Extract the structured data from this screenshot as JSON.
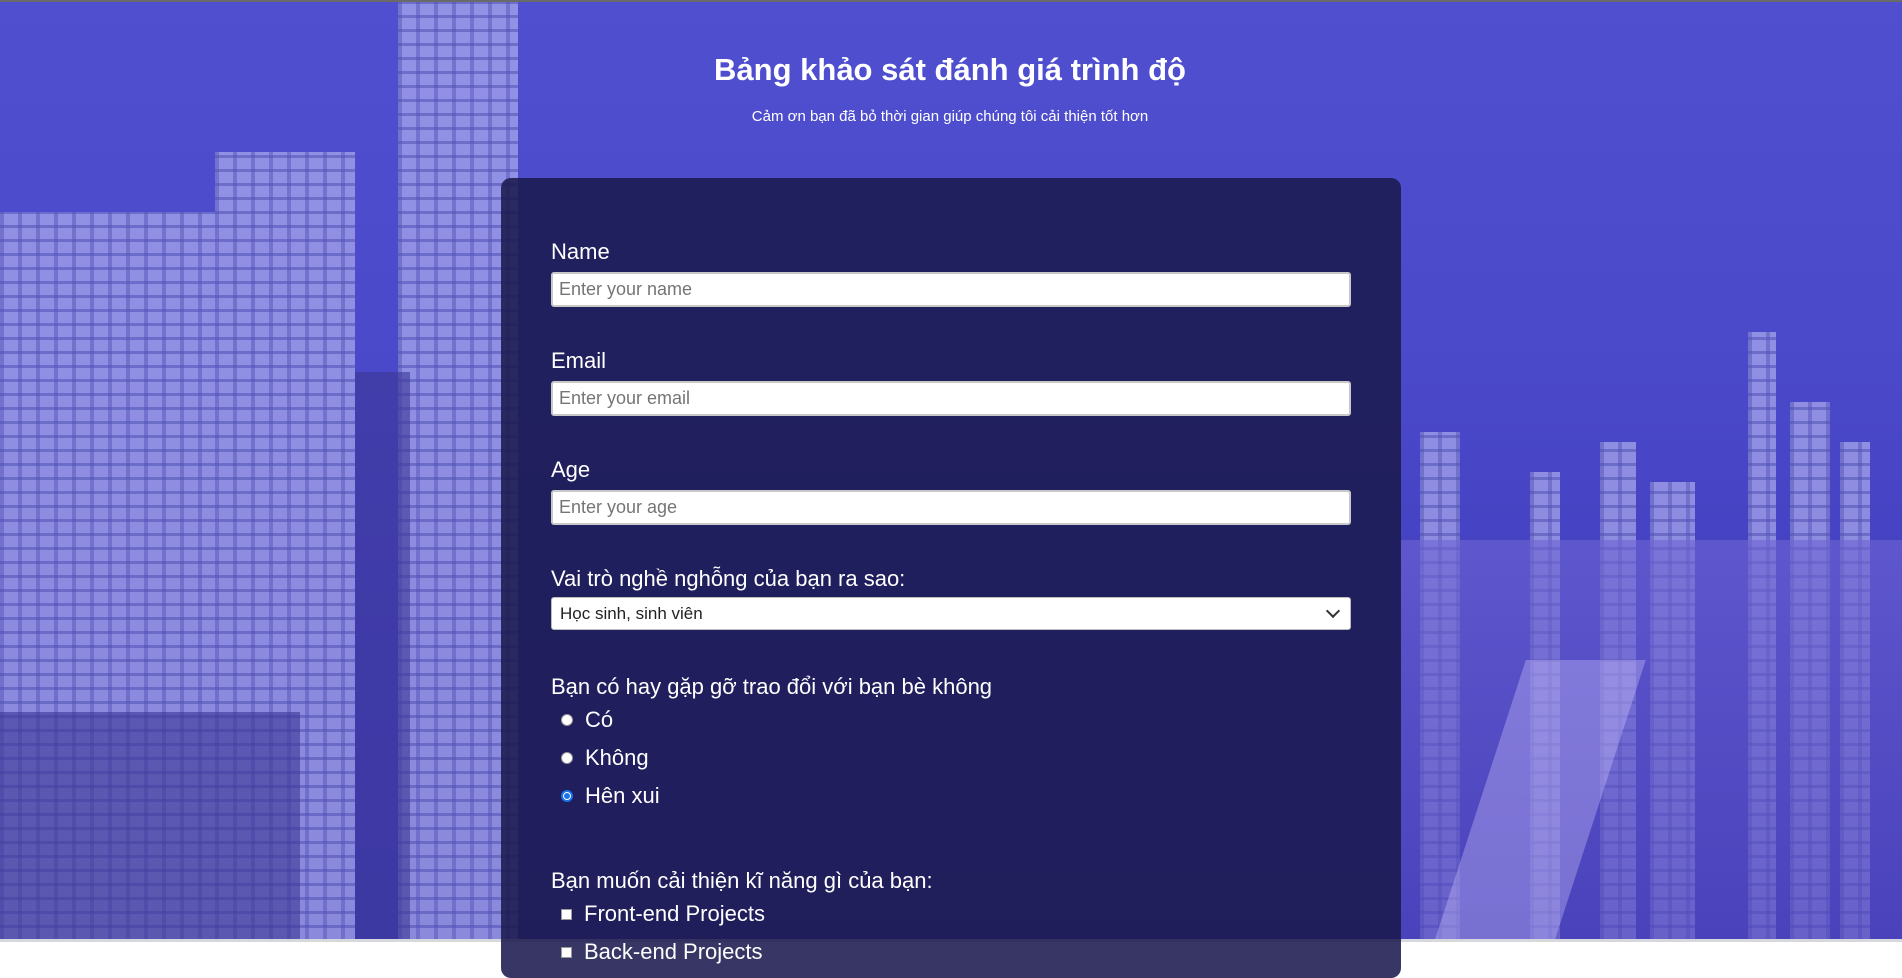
{
  "header": {
    "title": "Bảng khảo sát đánh giá trình độ",
    "subtitle": "Cảm ơn bạn đã bỏ thời gian giúp chúng tôi cải thiện tốt hơn"
  },
  "form": {
    "name": {
      "label": "Name",
      "placeholder": "Enter your name",
      "value": ""
    },
    "email": {
      "label": "Email",
      "placeholder": "Enter your email",
      "value": ""
    },
    "age": {
      "label": "Age",
      "placeholder": "Enter your age",
      "value": ""
    },
    "role": {
      "label": "Vai trò nghề nghỗng của bạn ra sao:",
      "selected": "Học sinh, sinh viên"
    },
    "meet_friends": {
      "label": "Bạn có hay gặp gỡ trao đổi với bạn bè không",
      "options": [
        "Có",
        "Không",
        "Hên xui"
      ],
      "selected_index": 2
    },
    "skills": {
      "label": "Bạn muốn cải thiện kĩ năng gì của bạn:",
      "options": [
        "Front-end Projects",
        "Back-end Projects"
      ]
    }
  },
  "colors": {
    "background_tint": "#4f4fcf",
    "form_background": "#1b1a4e",
    "radio_checked": "#1a73e8"
  }
}
